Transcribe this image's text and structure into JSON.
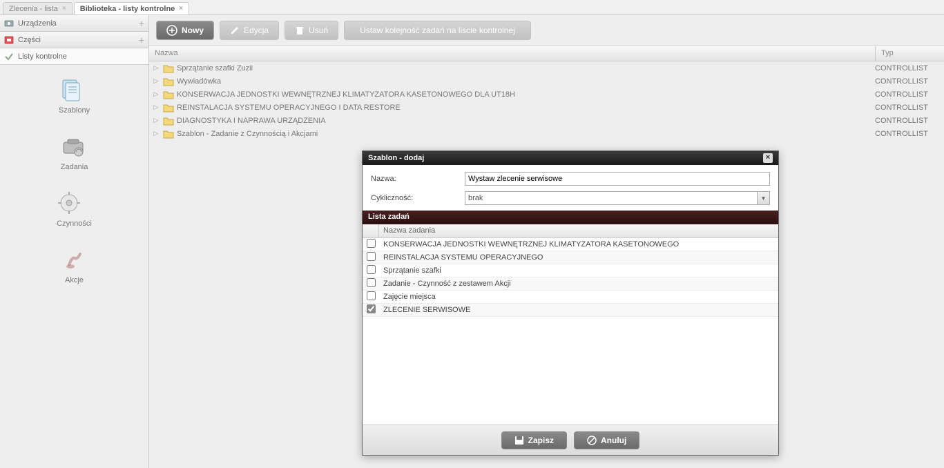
{
  "tabs": [
    {
      "label": "Zlecenia - lista",
      "active": false
    },
    {
      "label": "Biblioteka - listy kontrolne",
      "active": true
    }
  ],
  "sidebar": {
    "sections": [
      {
        "label": "Urządzenia",
        "icon": "devices"
      },
      {
        "label": "Części",
        "icon": "parts"
      },
      {
        "label": "Listy kontrolne",
        "icon": "check",
        "selected": true
      }
    ],
    "items": [
      {
        "label": "Szablony",
        "icon": "templates"
      },
      {
        "label": "Zadania",
        "icon": "tasks"
      },
      {
        "label": "Czynności",
        "icon": "activities"
      },
      {
        "label": "Akcje",
        "icon": "actions"
      }
    ]
  },
  "toolbar": {
    "new_label": "Nowy",
    "edit_label": "Edycja",
    "delete_label": "Usuń",
    "order_label": "Ustaw kolejność zadań na liscie kontrolnej"
  },
  "columns": {
    "name": "Nazwa",
    "type": "Typ"
  },
  "list": [
    {
      "name": "Sprzątanie szafki Zuzii",
      "type": "CONTROLLIST"
    },
    {
      "name": "Wywiadówka",
      "type": "CONTROLLIST"
    },
    {
      "name": "KONSERWACJA JEDNOSTKI WEWNĘTRZNEJ KLIMATYZATORA KASETONOWEGO DLA UT18H",
      "type": "CONTROLLIST"
    },
    {
      "name": "REINSTALACJA SYSTEMU OPERACYJNEGO I DATA RESTORE",
      "type": "CONTROLLIST"
    },
    {
      "name": "DIAGNOSTYKA I NAPRAWA URZĄDZENIA",
      "type": "CONTROLLIST"
    },
    {
      "name": "Szablon - Zadanie z Czynnością i Akcjami",
      "type": "CONTROLLIST"
    }
  ],
  "dialog": {
    "title": "Szablon - dodaj",
    "name_label": "Nazwa:",
    "name_value": "Wystaw zlecenie serwisowe",
    "cycle_label": "Cykliczność:",
    "cycle_value": "brak",
    "tasks_section": "Lista zadań",
    "task_col": "Nazwa zadania",
    "tasks": [
      {
        "name": "KONSERWACJA JEDNOSTKI WEWNĘTRZNEJ KLIMATYZATORA KASETONOWEGO",
        "checked": false
      },
      {
        "name": "REINSTALACJA SYSTEMU OPERACYJNEGO",
        "checked": false
      },
      {
        "name": "Sprzątanie szafki",
        "checked": false
      },
      {
        "name": "Zadanie - Czynność z zestawem Akcji",
        "checked": false
      },
      {
        "name": "Zajęcie miejsca",
        "checked": false
      },
      {
        "name": "ZLECENIE SERWISOWE",
        "checked": true
      }
    ],
    "save_label": "Zapisz",
    "cancel_label": "Anuluj"
  }
}
